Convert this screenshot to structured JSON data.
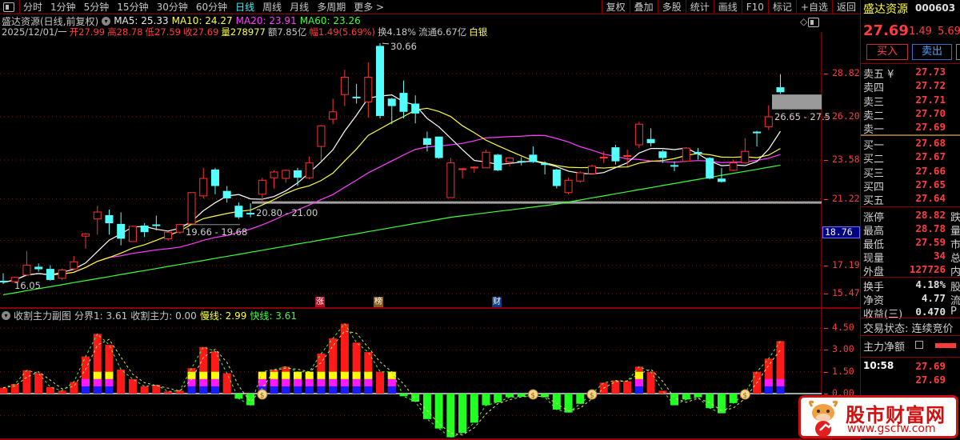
{
  "toolbar": {
    "periods": [
      "分时",
      "1分钟",
      "5分钟",
      "15分钟",
      "30分钟",
      "60分钟",
      "日线",
      "周线",
      "月线",
      "多周期",
      "更多 >"
    ],
    "active_period": "日线",
    "right_buttons": [
      "复权",
      "叠加",
      "多股",
      "统计",
      "画线",
      "F10",
      "标记",
      "+自选",
      "返回"
    ]
  },
  "info": {
    "title": "盛达资源(日线,前复权)",
    "ma5": "MA5: 25.33",
    "ma10": "MA10: 24.27",
    "ma20": "MA20: 23.91",
    "ma60": "MA60: 23.26",
    "date": "2025/12/01/一",
    "open": "开27.99",
    "high": "高28.78",
    "low": "低27.59",
    "close": "收27.69",
    "volume": "量278977",
    "amount": "额7.85亿",
    "change": "幅1.49(5.69%)",
    "turnover": "换4.18%",
    "float": "流通6.67亿",
    "sector": "白银"
  },
  "chart_data": {
    "type": "candlestick",
    "colors": {
      "up": "#ff3232",
      "down": "#54ffff",
      "ma5": "#ffffff",
      "ma10": "#ffff3c",
      "ma20": "#ff3cff",
      "ma60": "#3cff3c"
    },
    "price_axis": [
      "28.82",
      "26.20",
      "23.58",
      "21.22",
      "17.19",
      "15.47"
    ],
    "cursor_price": "18.76",
    "ylim": [
      15.47,
      28.82
    ],
    "candles_ohlc": [
      [
        16.2,
        16.7,
        16.05,
        16.15
      ],
      [
        16.2,
        16.5,
        16.1,
        16.45
      ],
      [
        16.6,
        18.05,
        16.55,
        17.2
      ],
      [
        17.1,
        17.3,
        16.8,
        16.95
      ],
      [
        16.97,
        17.2,
        16.25,
        16.3
      ],
      [
        16.4,
        17.0,
        16.3,
        16.9
      ],
      [
        16.97,
        17.75,
        16.9,
        17.4
      ],
      [
        18.96,
        19.15,
        18.2,
        19.1
      ],
      [
        20.0,
        20.8,
        19.05,
        20.42
      ],
      [
        20.23,
        20.57,
        19.05,
        19.74
      ],
      [
        19.7,
        20.4,
        18.4,
        18.8
      ],
      [
        18.63,
        19.6,
        18.6,
        19.55
      ],
      [
        19.6,
        19.75,
        18.9,
        19.2
      ],
      [
        19.62,
        20.2,
        19.3,
        19.58
      ],
      [
        18.8,
        19.25,
        18.7,
        19.2
      ],
      [
        19.2,
        19.7,
        19.1,
        19.66
      ],
      [
        19.7,
        21.6,
        19.7,
        21.6
      ],
      [
        21.4,
        23.1,
        21.25,
        22.46
      ],
      [
        23.0,
        23.1,
        21.5,
        22.0
      ],
      [
        21.7,
        22.0,
        21.0,
        21.25
      ],
      [
        20.8,
        21.0,
        20.0,
        20.1
      ],
      [
        20.32,
        20.95,
        20.1,
        20.28
      ],
      [
        21.5,
        22.5,
        21.0,
        22.35
      ],
      [
        22.5,
        22.95,
        21.85,
        22.85
      ],
      [
        22.46,
        23.0,
        22.2,
        22.95
      ],
      [
        22.95,
        23.1,
        22.0,
        22.5
      ],
      [
        22.5,
        23.8,
        22.4,
        23.4
      ],
      [
        24.4,
        25.7,
        23.5,
        25.65
      ],
      [
        26.05,
        27.3,
        25.75,
        26.5
      ],
      [
        27.55,
        29.05,
        26.85,
        28.6
      ],
      [
        27.37,
        28.2,
        27.0,
        27.33
      ],
      [
        27.1,
        29.5,
        26.15,
        28.6
      ],
      [
        30.5,
        30.66,
        26.1,
        26.25
      ],
      [
        27.3,
        27.35,
        25.75,
        26.85
      ],
      [
        27.65,
        28.4,
        26.1,
        26.5
      ],
      [
        27.0,
        27.5,
        25.8,
        26.4
      ],
      [
        24.9,
        25.3,
        24.1,
        24.5
      ],
      [
        25.0,
        25.0,
        23.65,
        23.7
      ],
      [
        21.3,
        23.7,
        21.3,
        23.4
      ],
      [
        22.98,
        23.1,
        22.45,
        23.02
      ],
      [
        23.08,
        23.2,
        22.8,
        23.12
      ],
      [
        23.1,
        24.2,
        23.1,
        24.05
      ],
      [
        23.9,
        23.95,
        22.9,
        22.95
      ],
      [
        23.45,
        23.75,
        23.2,
        23.7
      ],
      [
        23.47,
        23.75,
        23.25,
        23.43
      ],
      [
        23.9,
        24.4,
        23.4,
        23.45
      ],
      [
        23.32,
        23.5,
        22.7,
        23.28
      ],
      [
        23.0,
        23.05,
        21.85,
        22.0
      ],
      [
        21.6,
        22.5,
        21.5,
        22.35
      ],
      [
        22.3,
        22.9,
        22.2,
        22.8
      ],
      [
        22.75,
        23.3,
        22.7,
        23.2
      ],
      [
        23.68,
        24.1,
        23.4,
        23.72
      ],
      [
        24.35,
        24.5,
        23.3,
        23.5
      ],
      [
        23.78,
        24.2,
        23.2,
        23.82
      ],
      [
        24.5,
        25.9,
        24.3,
        25.75
      ],
      [
        24.85,
        25.5,
        24.4,
        24.6
      ],
      [
        24.1,
        24.2,
        23.4,
        23.7
      ],
      [
        23.22,
        23.5,
        22.9,
        23.18
      ],
      [
        23.5,
        24.35,
        23.45,
        24.3
      ],
      [
        24.02,
        24.3,
        23.6,
        23.98
      ],
      [
        23.7,
        23.75,
        22.4,
        22.45
      ],
      [
        22.45,
        23.1,
        22.2,
        22.25
      ],
      [
        22.95,
        23.6,
        22.9,
        23.4
      ],
      [
        23.4,
        24.9,
        23.35,
        24.1
      ],
      [
        25.3,
        25.35,
        24.4,
        25.2
      ],
      [
        25.6,
        26.9,
        25.4,
        26.2
      ],
      [
        27.99,
        28.78,
        27.59,
        27.69
      ]
    ],
    "ma60": [
      15.4,
      15.52,
      15.65,
      15.77,
      15.89,
      16.01,
      16.14,
      16.26,
      16.38,
      16.5,
      16.63,
      16.75,
      16.87,
      16.99,
      17.12,
      17.24,
      17.36,
      17.48,
      17.61,
      17.73,
      17.85,
      17.98,
      18.1,
      18.23,
      18.35,
      18.48,
      18.6,
      18.73,
      18.85,
      18.98,
      19.1,
      19.23,
      19.35,
      19.48,
      19.6,
      19.73,
      19.85,
      19.98,
      20.1,
      20.19,
      20.28,
      20.37,
      20.46,
      20.54,
      20.63,
      20.72,
      20.81,
      20.9,
      21.03,
      21.15,
      21.28,
      21.4,
      21.53,
      21.65,
      21.78,
      21.9,
      22.03,
      22.15,
      22.28,
      22.4,
      22.52,
      22.65,
      22.77,
      22.89,
      23.01,
      23.14,
      23.26
    ],
    "annotations": {
      "high": "30.66",
      "low": "16.05",
      "range1": "26.65 - 27.5",
      "range2": "20.80 - 21.00",
      "range3": "19.66 - 19.68"
    },
    "events": [
      {
        "label": "涨",
        "color": "#b01020"
      },
      {
        "label": "榜",
        "color": "#8a5a10"
      },
      {
        "label": "财",
        "color": "#103a80"
      }
    ]
  },
  "sub_chart": {
    "title": "收割主力副图",
    "boundary": "分界1: 3.61",
    "harvest": "收割主力: 0.00",
    "slow": "慢线: 2.99",
    "fast": "快线: 3.61",
    "axis": [
      "4.50",
      "3.00",
      "1.50",
      "0.00"
    ],
    "values": [
      0.4,
      0.65,
      1.6,
      1.4,
      0.45,
      0.2,
      0.8,
      2.55,
      4.1,
      3.35,
      1.65,
      1.0,
      0.5,
      0.6,
      0.15,
      0.2,
      1.75,
      3.2,
      2.9,
      1.4,
      -0.35,
      -0.8,
      1.5,
      1.65,
      1.85,
      1.5,
      1.5,
      2.75,
      3.8,
      4.8,
      3.5,
      2.85,
      1.5,
      1.5,
      -0.18,
      -0.55,
      -1.75,
      -2.4,
      -3.0,
      -2.7,
      -2.0,
      -0.8,
      -0.6,
      -0.25,
      -0.2,
      -0.15,
      -0.25,
      -1.1,
      -1.3,
      -0.7,
      0.0,
      0.75,
      0.9,
      0.85,
      1.85,
      1.5,
      0.2,
      -0.8,
      -0.4,
      -0.25,
      -1.0,
      -1.35,
      -0.65,
      0.0,
      1.5,
      2.4,
      3.61
    ],
    "stack": "RRRRRRRMFFRRRRRRFFFRGGFFFFFFFFFFRFGGGGGGGGGGGGGGGGRRRRFRRGGGGGGGRMM",
    "money_bags": [
      22,
      45,
      50,
      63
    ]
  },
  "panel": {
    "name": "盛达资源",
    "code": "000603",
    "price": "27.69",
    "change": "1.49",
    "pct": "5.69%",
    "buy_btn": "买入",
    "sell_btn": "卖出",
    "asks": [
      {
        "l": "卖五 ¥",
        "v": "27.73"
      },
      {
        "l": "卖四",
        "v": "27.72"
      },
      {
        "l": "卖三",
        "v": "27.71"
      },
      {
        "l": "卖二",
        "v": "27.70"
      },
      {
        "l": "卖一",
        "v": "27.69"
      }
    ],
    "bids": [
      {
        "l": "买一",
        "v": "27.68"
      },
      {
        "l": "买二",
        "v": "27.67"
      },
      {
        "l": "买三",
        "v": "27.66"
      },
      {
        "l": "买四",
        "v": "27.65"
      },
      {
        "l": "买五",
        "v": "27.64"
      }
    ],
    "stats": [
      {
        "l": "涨停",
        "v": "28.82",
        "t": "跌"
      },
      {
        "l": "最高",
        "v": "28.78",
        "t": "量"
      },
      {
        "l": "最低",
        "v": "27.59",
        "t": "市"
      },
      {
        "l": "现量",
        "v": "34",
        "t": "总"
      },
      {
        "l": "外盘",
        "v": "127726",
        "t": "内"
      }
    ],
    "stats2": [
      {
        "l": "换手",
        "v": "4.18%",
        "t": "股"
      },
      {
        "l": "净资",
        "v": "4.77",
        "t": "流"
      },
      {
        "l": "收益(三)",
        "v": "0.470",
        "t": "P"
      }
    ],
    "status": "交易状态: 连续竞价",
    "net_main": "主力净额",
    "ticks": [
      {
        "t": "10:58",
        "v": "27.69"
      },
      {
        "t": "",
        "v": "27.69"
      }
    ]
  },
  "watermark": {
    "name": "股市财富网",
    "url": "www.gscfw.com"
  }
}
